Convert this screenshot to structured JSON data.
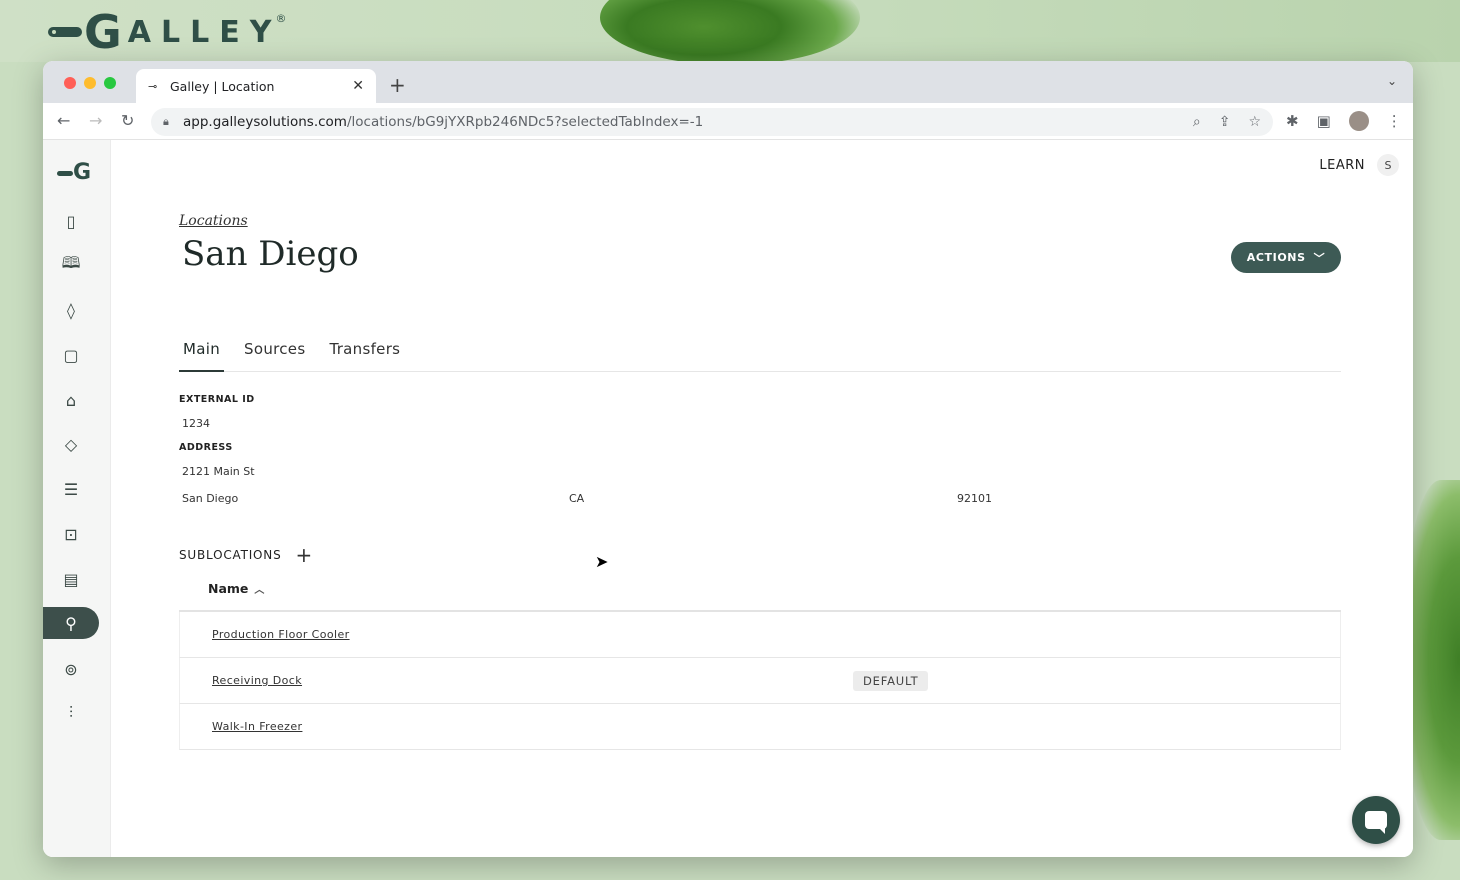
{
  "brand": {
    "name": "ALLEY",
    "g": "G",
    "reg": "®"
  },
  "browser": {
    "tab_title": "Galley | Location",
    "url_host": "app.galleysolutions.com",
    "url_path": "/locations/bG9jYXRpb246NDc5?selectedTabIndex=-1"
  },
  "header": {
    "learn_label": "LEARN",
    "user_initial": "S"
  },
  "page": {
    "breadcrumb": "Locations",
    "title": "San Diego",
    "actions_label": "ACTIONS"
  },
  "tabs": [
    {
      "label": "Main",
      "active": true
    },
    {
      "label": "Sources",
      "active": false
    },
    {
      "label": "Transfers",
      "active": false
    }
  ],
  "details": {
    "external_id_label": "EXTERNAL ID",
    "external_id": "1234",
    "address_label": "ADDRESS",
    "street": "2121 Main St",
    "city": "San Diego",
    "state": "CA",
    "zip": "92101"
  },
  "sublocations": {
    "title": "SUBLOCATIONS",
    "column_name": "Name",
    "rows": [
      {
        "name": "Production Floor Cooler",
        "badge": ""
      },
      {
        "name": "Receiving Dock",
        "badge": "DEFAULT"
      },
      {
        "name": "Walk-In Freezer",
        "badge": ""
      }
    ]
  },
  "sidebar": {
    "items": [
      {
        "icon": "clipboard-icon"
      },
      {
        "icon": "book-icon"
      },
      {
        "icon": "ingredient-icon"
      },
      {
        "icon": "containers-icon"
      },
      {
        "icon": "chef-hat-icon"
      },
      {
        "icon": "tag-icon"
      },
      {
        "icon": "checklist-icon"
      },
      {
        "icon": "cart-icon"
      },
      {
        "icon": "document-icon"
      },
      {
        "icon": "location-pin-icon",
        "active": true
      },
      {
        "icon": "plate-utensils-icon"
      },
      {
        "icon": "sliders-icon"
      }
    ]
  }
}
